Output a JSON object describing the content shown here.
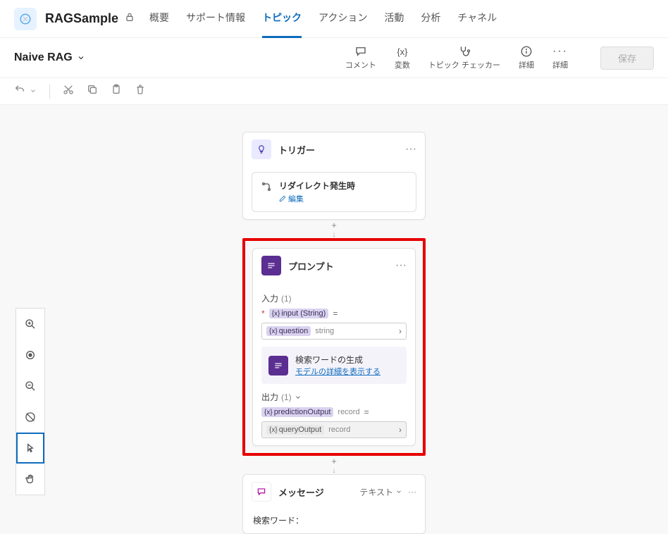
{
  "header": {
    "app_title": "RAGSample",
    "tabs": [
      "概要",
      "サポート情報",
      "トピック",
      "アクション",
      "活動",
      "分析",
      "チャネル"
    ],
    "active_tab_index": 2
  },
  "secbar": {
    "topic_name": "Naive RAG",
    "actions": {
      "comment": "コメント",
      "variables": "変数",
      "checker": "トピック チェッカー",
      "details1": "詳細",
      "details2": "詳細"
    },
    "save": "保存"
  },
  "trigger_node": {
    "title": "トリガー",
    "redirect_title": "リダイレクト発生時",
    "edit": "編集"
  },
  "prompt_node": {
    "title": "プロンプト",
    "input_label": "入力",
    "input_count": "(1)",
    "input_var": "input (String)",
    "question_var": "question",
    "question_type": "string",
    "gen_title": "検索ワードの生成",
    "gen_link": "モデルの詳細を表示する",
    "output_label": "出力",
    "output_count": "(1)",
    "prediction_var": "predictionOutput",
    "prediction_type": "record",
    "query_var": "queryOutput",
    "query_type": "record"
  },
  "message_node": {
    "title": "メッセージ",
    "type_label": "テキスト",
    "body": "検索ワード："
  }
}
